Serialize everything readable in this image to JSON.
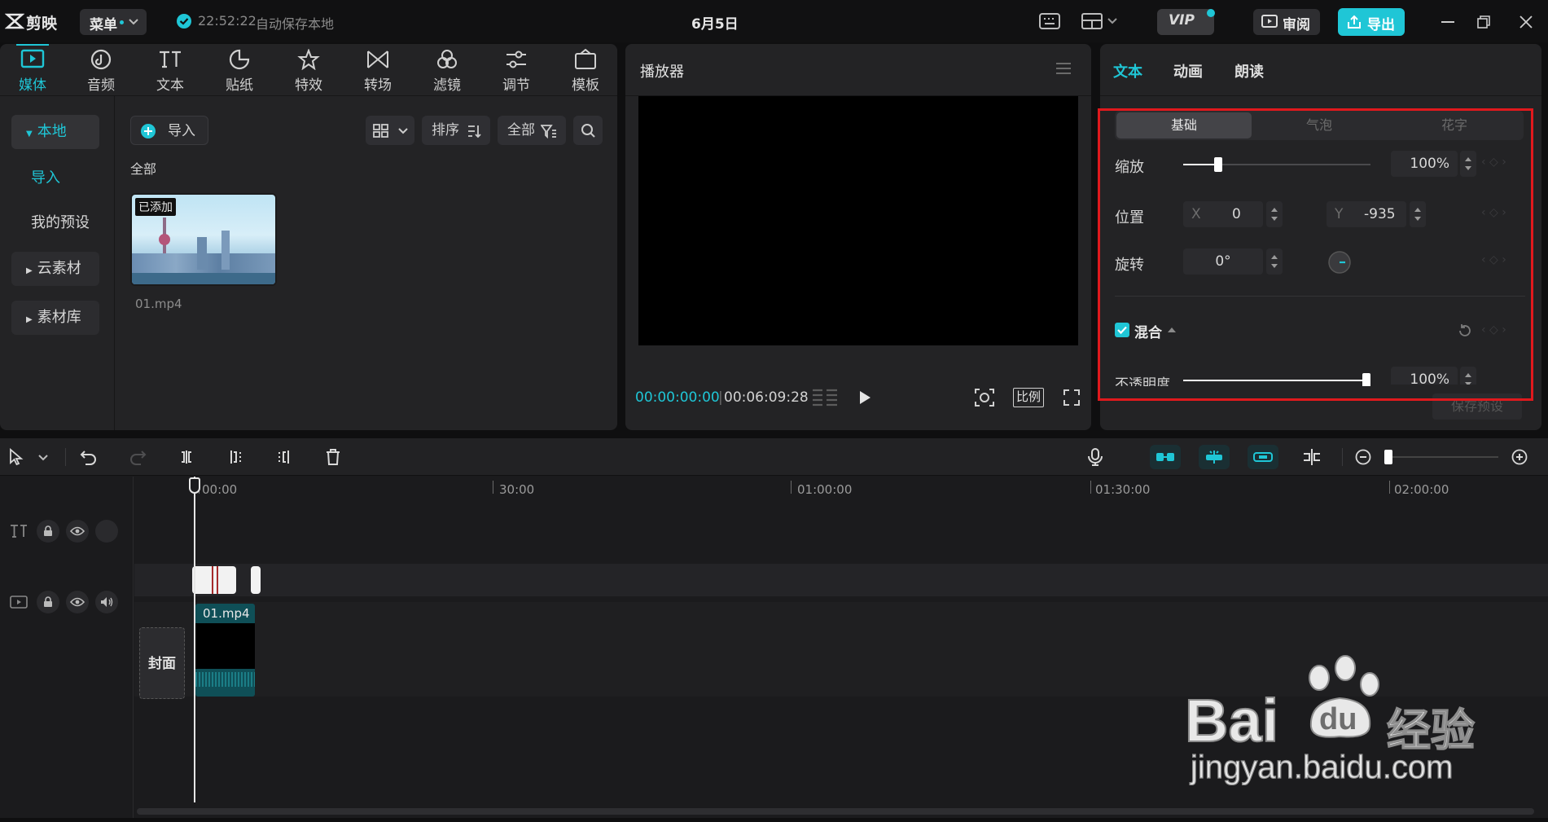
{
  "titlebar": {
    "app_name": "剪映",
    "menu_label": "菜单",
    "autosave_time": "22:52:22",
    "autosave_text": "自动保存本地",
    "project_title": "6月5日",
    "vip_label": "VIP",
    "review_label": "审阅",
    "export_label": "导出"
  },
  "media_tools": [
    "媒体",
    "音频",
    "文本",
    "贴纸",
    "特效",
    "转场",
    "滤镜",
    "调节",
    "模板"
  ],
  "media_sidebar": {
    "local": "本地",
    "import": "导入",
    "presets": "我的预设",
    "cloud": "云素材",
    "library": "素材库"
  },
  "media_toolbar": {
    "import_button": "导入",
    "sort_label": "排序",
    "filter_label": "全部",
    "section_label": "全部"
  },
  "media_item": {
    "badge": "已添加",
    "filename": "01.mp4"
  },
  "player": {
    "title": "播放器",
    "current_time": "00:00:00:00",
    "total_time": "00:06:09:28",
    "ratio_label": "比例"
  },
  "props": {
    "tabs": [
      "文本",
      "动画",
      "朗读"
    ],
    "subtabs": [
      "基础",
      "气泡",
      "花字"
    ],
    "scale_label": "缩放",
    "scale_value": "100%",
    "scale_fraction": 0.21,
    "position_label": "位置",
    "x_label": "X",
    "x_value": "0",
    "y_label": "Y",
    "y_value": "-935",
    "rotate_label": "旋转",
    "rotate_value": "0°",
    "blend_label": "混合",
    "opacity_label": "不透明度",
    "opacity_value": "100%",
    "opacity_fraction": 1.0,
    "save_preset": "保存预设"
  },
  "timeline": {
    "ruler": [
      "00:00",
      "30:00",
      "01:00:00",
      "01:30:00",
      "02:00:00"
    ],
    "cover_label": "封面",
    "clip_label": "01.mp4"
  },
  "watermark": {
    "brand": "Bai",
    "brand2": "du",
    "suffix": "经验",
    "url": "jingyan.baidu.com"
  },
  "colors": {
    "accent": "#1fc6d6",
    "highlight_box": "#e0191d",
    "panel": "#232325"
  }
}
